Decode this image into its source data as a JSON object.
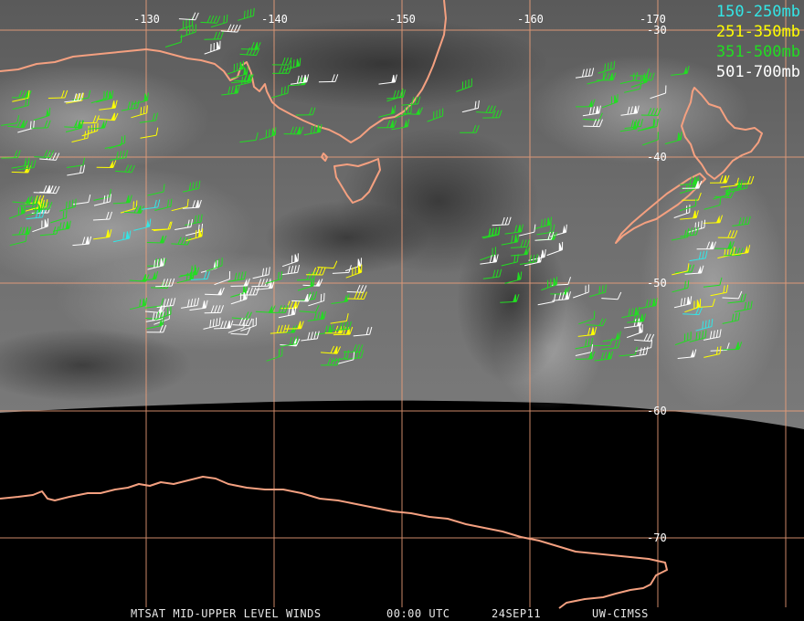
{
  "legend": {
    "items": [
      {
        "label": "150-250mb",
        "color": "#33e6e6"
      },
      {
        "label": "251-350mb",
        "color": "#ffff00"
      },
      {
        "label": "351-500mb",
        "color": "#22dd22"
      },
      {
        "label": "501-700mb",
        "color": "#ffffff"
      }
    ]
  },
  "grid": {
    "longitude_labels": [
      "-130",
      "-140",
      "-150",
      "-160",
      "-170"
    ],
    "latitude_labels": [
      "-30",
      "-40",
      "-50",
      "-60",
      "-70"
    ],
    "line_color": "#f0a07a"
  },
  "coast_color": "#f4a080",
  "footer": {
    "product": "MTSAT MID-UPPER LEVEL WINDS",
    "time": "00:00 UTC",
    "date": "24SEP11",
    "source": "UW-CIMSS"
  }
}
